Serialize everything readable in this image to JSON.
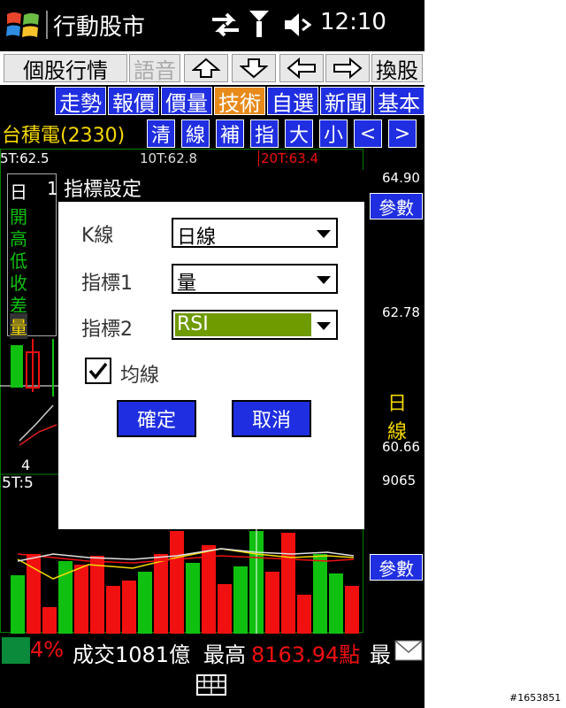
{
  "titlebar": {
    "app_title": "行動股市",
    "clock": "12:10"
  },
  "toolbar": {
    "stock_quote": "個股行情",
    "voice": "語音",
    "change_stock": "換股"
  },
  "nav_tabs": [
    {
      "label": "走勢",
      "active": false
    },
    {
      "label": "報價",
      "active": false
    },
    {
      "label": "價量",
      "active": false
    },
    {
      "label": "技術",
      "active": true
    },
    {
      "label": "自選",
      "active": false
    },
    {
      "label": "新聞",
      "active": false
    },
    {
      "label": "基本",
      "active": false
    }
  ],
  "stock": {
    "name": "台積電(2330)"
  },
  "chart_tools": [
    "清",
    "線",
    "補",
    "指",
    "大",
    "小",
    "<",
    ">"
  ],
  "chart": {
    "legend_ma5_top": "5T:62.5",
    "legend_10t": "10T:62.8",
    "legend_20t": "20T:63.4",
    "side_labels": [
      "日",
      "開",
      "高",
      "低",
      "收",
      "差",
      "量"
    ],
    "side_day": "1",
    "left_count": "4",
    "legend_ma5_bottom": "5T:5",
    "price_top": "64.90",
    "price_mid": "62.78",
    "price_low": "60.66",
    "volume_value": "9065",
    "kline_label": "日線",
    "param_label": "參數"
  },
  "dialog": {
    "title": "指標設定",
    "kline_label": "K線",
    "kline_value": "日線",
    "indicator1_label": "指標1",
    "indicator1_value": "量",
    "indicator2_label": "指標2",
    "indicator2_value": "RSI",
    "ma_checkbox_label": "均線",
    "ma_checked": true,
    "ok_label": "確定",
    "cancel_label": "取消"
  },
  "status": {
    "pct_text": "4%",
    "volume_text": "成交1081億",
    "high_label": "最高",
    "high_value": "8163.94點",
    "tail": "最"
  },
  "watermark": "#1653851",
  "colors": {
    "tab_blue": "#1f2ee0",
    "tab_active": "#e88a1a",
    "stock_yellow": "#f5d800",
    "rsi_green": "#6f9a00",
    "up_red": "#f01010",
    "down_green": "#10c010"
  }
}
